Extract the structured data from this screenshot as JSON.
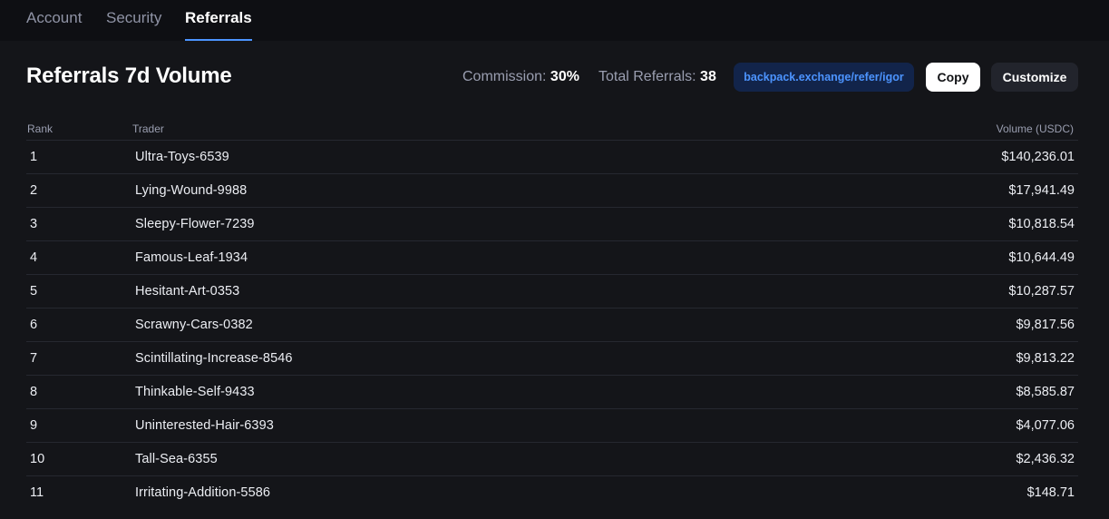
{
  "tabs": [
    {
      "label": "Account",
      "active": false
    },
    {
      "label": "Security",
      "active": false
    },
    {
      "label": "Referrals",
      "active": true
    }
  ],
  "header": {
    "title": "Referrals 7d Volume",
    "commission_label": "Commission:",
    "commission_value": "30%",
    "total_referrals_label": "Total Referrals:",
    "total_referrals_value": "38",
    "referral_link": "backpack.exchange/refer/igor",
    "copy_label": "Copy",
    "customize_label": "Customize"
  },
  "table": {
    "columns": [
      "Rank",
      "Trader",
      "Volume (USDC)"
    ],
    "rows": [
      {
        "rank": "1",
        "trader": "Ultra-Toys-6539",
        "volume": "$140,236.01"
      },
      {
        "rank": "2",
        "trader": "Lying-Wound-9988",
        "volume": "$17,941.49"
      },
      {
        "rank": "3",
        "trader": "Sleepy-Flower-7239",
        "volume": "$10,818.54"
      },
      {
        "rank": "4",
        "trader": "Famous-Leaf-1934",
        "volume": "$10,644.49"
      },
      {
        "rank": "5",
        "trader": "Hesitant-Art-0353",
        "volume": "$10,287.57"
      },
      {
        "rank": "6",
        "trader": "Scrawny-Cars-0382",
        "volume": "$9,817.56"
      },
      {
        "rank": "7",
        "trader": "Scintillating-Increase-8546",
        "volume": "$9,813.22"
      },
      {
        "rank": "8",
        "trader": "Thinkable-Self-9433",
        "volume": "$8,585.87"
      },
      {
        "rank": "9",
        "trader": "Uninterested-Hair-6393",
        "volume": "$4,077.06"
      },
      {
        "rank": "10",
        "trader": "Tall-Sea-6355",
        "volume": "$2,436.32"
      },
      {
        "rank": "11",
        "trader": "Irritating-Addition-5586",
        "volume": "$148.71"
      }
    ]
  },
  "colors": {
    "background": "#141519",
    "tabbar": "#0e0f13",
    "accent": "#4c94ff",
    "link_bg": "#12244a"
  }
}
